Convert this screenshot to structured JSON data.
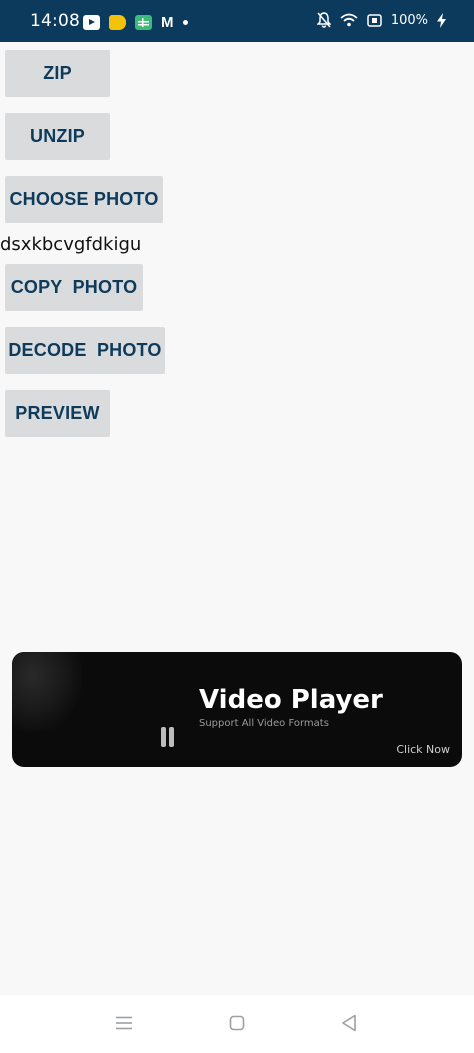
{
  "status_bar": {
    "time": "14:08",
    "battery": "100%",
    "notification_icons": [
      "youtube-icon",
      "tag-icon",
      "sheets-icon",
      "gmail-icon",
      "dot-icon"
    ],
    "system_icons": [
      "mute-bell-icon",
      "wifi-icon",
      "screen-record-icon",
      "battery-icon",
      "charging-icon"
    ],
    "background_color": "#0c3a5c"
  },
  "buttons": {
    "zip": "ZIP",
    "unzip": "UNZIP",
    "choose_photo": "CHOOSE PHOTO",
    "copy_photo": "COPY  PHOTO",
    "decode_photo": "DECODE  PHOTO",
    "preview": "PREVIEW"
  },
  "status_text": "dsxkbcvgfdkigu",
  "ad": {
    "title": "Video Player",
    "subtitle": "Support All Video Formats",
    "cta": "Click Now"
  },
  "colors": {
    "button_bg": "#d9dbdc",
    "button_text": "#0e3b5b",
    "page_bg": "#f8f8f8",
    "ad_bg": "#0b0b0c"
  },
  "nav_bar": {
    "buttons": [
      "menu-icon",
      "home-icon",
      "back-icon"
    ]
  }
}
